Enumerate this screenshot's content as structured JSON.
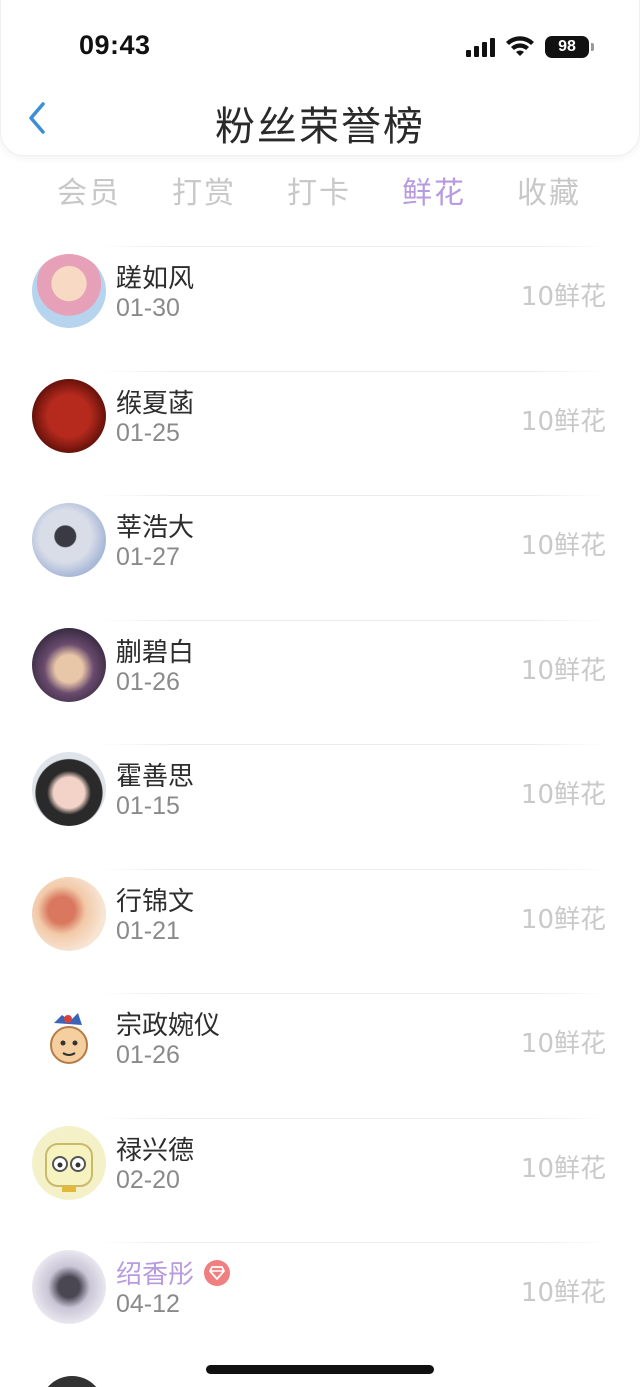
{
  "status_bar": {
    "time": "09:43",
    "battery": "98"
  },
  "header": {
    "title": "粉丝荣誉榜",
    "back_icon": "chevron-left-icon"
  },
  "colors": {
    "accent": "#b79ae0",
    "back": "#3a8fd8",
    "muted": "#c9c9c9",
    "vip_badge": "#f07f7f"
  },
  "tabs": [
    {
      "label": "会员",
      "active": false
    },
    {
      "label": "打赏",
      "active": false
    },
    {
      "label": "打卡",
      "active": false
    },
    {
      "label": "鲜花",
      "active": true
    },
    {
      "label": "收藏",
      "active": false
    }
  ],
  "fans": [
    {
      "name": "蹉如风",
      "date": "01-30",
      "amount": "10鲜花",
      "vip": false
    },
    {
      "name": "缑夏菡",
      "date": "01-25",
      "amount": "10鲜花",
      "vip": false
    },
    {
      "name": "莘浩大",
      "date": "01-27",
      "amount": "10鲜花",
      "vip": false
    },
    {
      "name": "蒯碧白",
      "date": "01-26",
      "amount": "10鲜花",
      "vip": false
    },
    {
      "name": "霍善思",
      "date": "01-15",
      "amount": "10鲜花",
      "vip": false
    },
    {
      "name": "行锦文",
      "date": "01-21",
      "amount": "10鲜花",
      "vip": false
    },
    {
      "name": "宗政婉仪",
      "date": "01-26",
      "amount": "10鲜花",
      "vip": false
    },
    {
      "name": "禄兴德",
      "date": "02-20",
      "amount": "10鲜花",
      "vip": false
    },
    {
      "name": "绍香彤",
      "date": "04-12",
      "amount": "10鲜花",
      "vip": true
    }
  ]
}
